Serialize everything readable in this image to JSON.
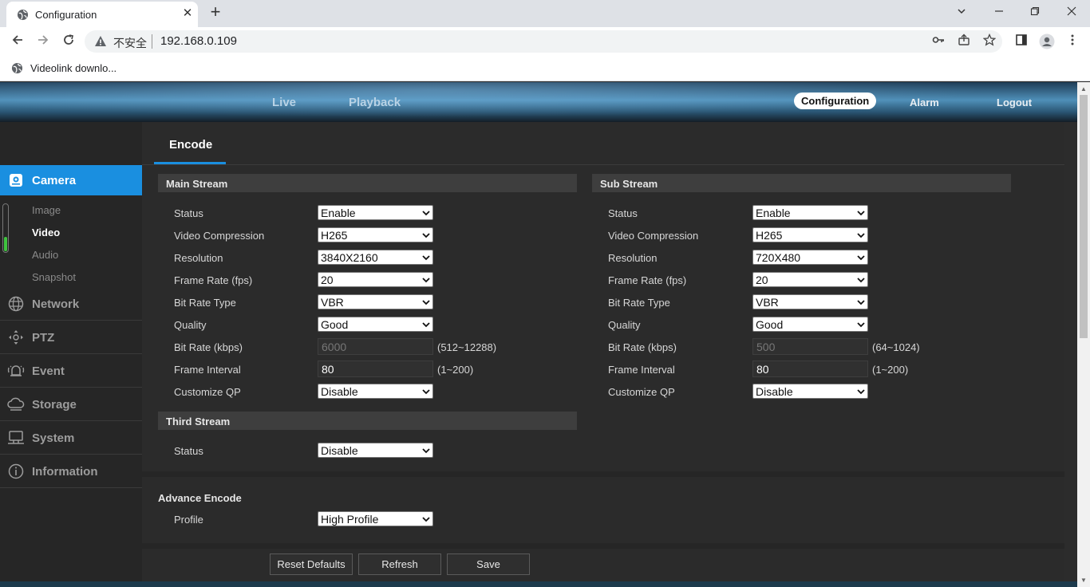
{
  "browser": {
    "tab_title": "Configuration",
    "tab_close": "✕",
    "new_tab": "+",
    "insecure_label": "不安全",
    "url": "192.168.0.109",
    "bookmark": "Videolink downlo..."
  },
  "header": {
    "live": "Live",
    "playback": "Playback",
    "configuration": "Configuration",
    "alarm": "Alarm",
    "logout": "Logout"
  },
  "sidebar": {
    "camera": "Camera",
    "camera_sub": [
      "Image",
      "Video",
      "Audio",
      "Snapshot"
    ],
    "active_sub": "Video",
    "items": [
      "Network",
      "PTZ",
      "Event",
      "Storage",
      "System",
      "Information"
    ]
  },
  "page": {
    "tab": "Encode"
  },
  "main_stream": {
    "title": "Main Stream",
    "labels": [
      "Status",
      "Video Compression",
      "Resolution",
      "Frame Rate (fps)",
      "Bit Rate Type",
      "Quality",
      "Bit Rate (kbps)",
      "Frame Interval",
      "Customize QP"
    ],
    "status": "Enable",
    "video_compression": "H265",
    "resolution": "3840X2160",
    "frame_rate": "20",
    "bit_rate_type": "VBR",
    "quality": "Good",
    "bit_rate": "6000",
    "bit_rate_range": "(512~12288)",
    "frame_interval": "80",
    "frame_interval_range": "(1~200)",
    "customize_qp": "Disable"
  },
  "sub_stream": {
    "title": "Sub Stream",
    "labels": [
      "Status",
      "Video Compression",
      "Resolution",
      "Frame Rate (fps)",
      "Bit Rate Type",
      "Quality",
      "Bit Rate (kbps)",
      "Frame Interval",
      "Customize QP"
    ],
    "status": "Enable",
    "video_compression": "H265",
    "resolution": "720X480",
    "frame_rate": "20",
    "bit_rate_type": "VBR",
    "quality": "Good",
    "bit_rate": "500",
    "bit_rate_range": "(64~1024)",
    "frame_interval": "80",
    "frame_interval_range": "(1~200)",
    "customize_qp": "Disable"
  },
  "third_stream": {
    "title": "Third Stream",
    "status_label": "Status",
    "status": "Disable"
  },
  "advance_encode": {
    "title": "Advance Encode",
    "profile_label": "Profile",
    "profile": "High Profile"
  },
  "buttons": {
    "reset": "Reset Defaults",
    "refresh": "Refresh",
    "save": "Save"
  },
  "colors": {
    "accent": "#1a8fe0",
    "progress_green": "#3fc33f"
  }
}
